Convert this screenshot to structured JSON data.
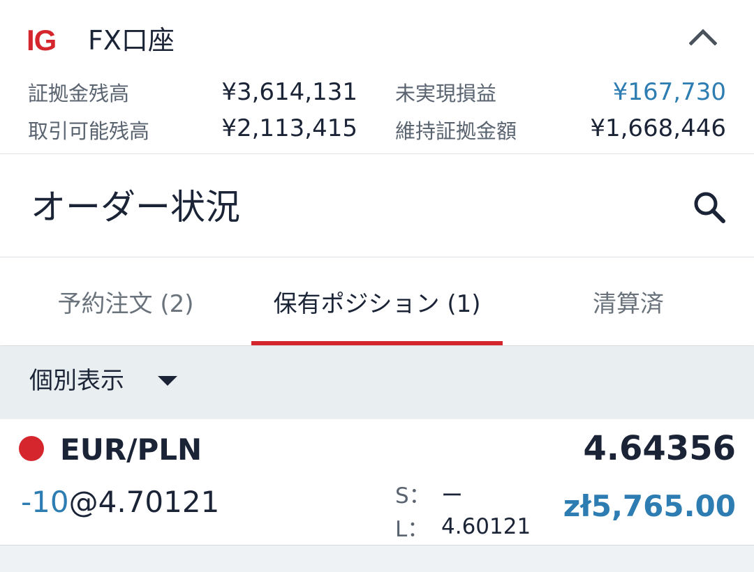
{
  "colors": {
    "brand_red": "#d5262e",
    "profit_blue": "#2d7db3",
    "short_blue": "#2d7db3"
  },
  "account": {
    "logo": "IG",
    "title": "FX口座",
    "collapse_icon": "chevron-up-icon",
    "metrics": {
      "margin_balance_label": "証拠金残高",
      "margin_balance_value": "¥3,614,131",
      "available_label": "取引可能残高",
      "available_value": "¥2,113,415",
      "unrealized_label": "未実現損益",
      "unrealized_value": "¥167,730",
      "required_margin_label": "維持証拠金額",
      "required_margin_value": "¥1,668,446"
    }
  },
  "page": {
    "title": "オーダー状況",
    "search_icon": "search-icon"
  },
  "tabs": [
    {
      "label": "予約注文 (2)",
      "active": false
    },
    {
      "label": "保有ポジション (1)",
      "active": true
    },
    {
      "label": "清算済",
      "active": false
    }
  ],
  "filter": {
    "selected": "個別表示",
    "icon": "caret-down-icon"
  },
  "positions": [
    {
      "direction_color": "#d5262e",
      "instrument": "EUR/PLN",
      "price": "4.64356",
      "size": "-10",
      "at_sign": "@",
      "open_level": "4.70121",
      "stop_label": "S：",
      "stop_value": "ー",
      "limit_label": "L：",
      "limit_value": "4.60121",
      "pnl": "zł5,765.00"
    }
  ]
}
